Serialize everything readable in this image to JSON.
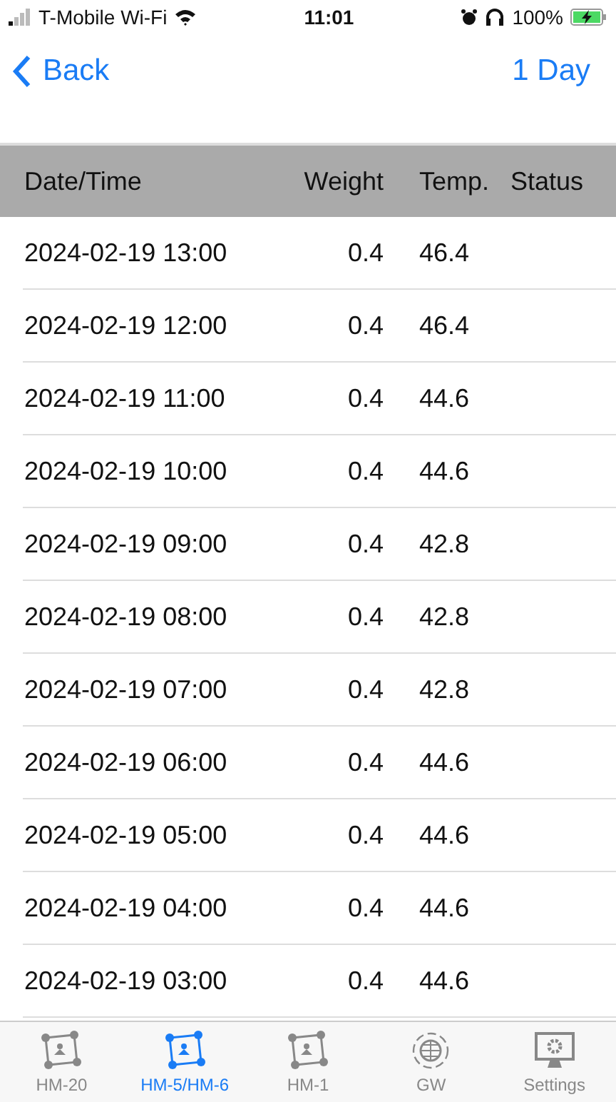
{
  "status_bar": {
    "carrier": "T-Mobile Wi-Fi",
    "time": "11:01",
    "battery": "100%"
  },
  "nav": {
    "back": "Back",
    "range": "1 Day"
  },
  "table": {
    "columns": [
      "Date/Time",
      "Weight",
      "Temp.",
      "Status"
    ],
    "rows": [
      {
        "datetime": "2024-02-19 13:00",
        "weight": "0.4",
        "temp": "46.4"
      },
      {
        "datetime": "2024-02-19 12:00",
        "weight": "0.4",
        "temp": "46.4"
      },
      {
        "datetime": "2024-02-19 11:00",
        "weight": "0.4",
        "temp": "44.6"
      },
      {
        "datetime": "2024-02-19 10:00",
        "weight": "0.4",
        "temp": "44.6"
      },
      {
        "datetime": "2024-02-19 09:00",
        "weight": "0.4",
        "temp": "42.8"
      },
      {
        "datetime": "2024-02-19 08:00",
        "weight": "0.4",
        "temp": "42.8"
      },
      {
        "datetime": "2024-02-19 07:00",
        "weight": "0.4",
        "temp": "42.8"
      },
      {
        "datetime": "2024-02-19 06:00",
        "weight": "0.4",
        "temp": "44.6"
      },
      {
        "datetime": "2024-02-19 05:00",
        "weight": "0.4",
        "temp": "44.6"
      },
      {
        "datetime": "2024-02-19 04:00",
        "weight": "0.4",
        "temp": "44.6"
      },
      {
        "datetime": "2024-02-19 03:00",
        "weight": "0.4",
        "temp": "44.6"
      }
    ]
  },
  "tab_bar": [
    {
      "label": "HM-20",
      "kind": "device",
      "selected": false
    },
    {
      "label": "HM-5/HM-6",
      "kind": "device",
      "selected": true
    },
    {
      "label": "HM-1",
      "kind": "device",
      "selected": false
    },
    {
      "label": "GW",
      "kind": "globe",
      "selected": false
    },
    {
      "label": "Settings",
      "kind": "monitor",
      "selected": false
    }
  ]
}
